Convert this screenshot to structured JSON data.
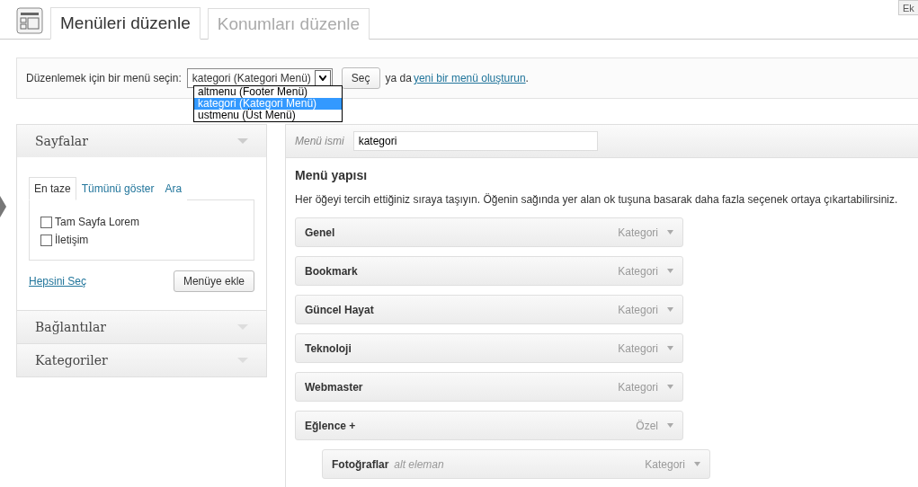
{
  "top_button": "Ek",
  "tabs": [
    {
      "label": "Menüleri düzenle",
      "selected": true
    },
    {
      "label": "Konumları düzenle",
      "selected": false
    }
  ],
  "menu_select": {
    "label": "Düzenlemek için bir menü seçin:",
    "value": "kategori (Kategori Menü)",
    "button": "Seç",
    "or_text": "ya da",
    "create_link": "yeni bir menü oluşturun",
    "end": ".",
    "open": true,
    "options": [
      {
        "label": "altmenu (Footer Menü)",
        "selected": false
      },
      {
        "label": "kategori (Kategori Menü)",
        "selected": true
      },
      {
        "label": "ustmenu (Üst Menü)",
        "selected": false
      }
    ]
  },
  "sidebar": [
    {
      "title": "Sayfalar",
      "expanded": true,
      "tabs": [
        {
          "label": "En taze",
          "selected": true
        },
        {
          "label": "Tümünü göster",
          "selected": false
        },
        {
          "label": "Ara",
          "selected": false
        }
      ],
      "items": [
        {
          "label": "Tam Sayfa Lorem",
          "checked": false
        },
        {
          "label": "İletişim",
          "checked": false
        }
      ],
      "select_all": "Hepsini Seç",
      "add_button": "Menüye ekle"
    },
    {
      "title": "Bağlantılar",
      "expanded": false
    },
    {
      "title": "Kategoriler",
      "expanded": false
    }
  ],
  "editor": {
    "name_label": "Menü ismi",
    "name_value": "kategori",
    "heading": "Menü yapısı",
    "help": "Her öğeyi tercih ettiğiniz sıraya taşıyın. Öğenin sağında yer alan ok tuşuna basarak daha fazla seçenek ortaya çıkartabilirsiniz.",
    "items": [
      {
        "title": "Genel",
        "type": "Kategori"
      },
      {
        "title": "Bookmark",
        "type": "Kategori"
      },
      {
        "title": "Güncel Hayat",
        "type": "Kategori"
      },
      {
        "title": "Teknoloji",
        "type": "Kategori"
      },
      {
        "title": "Webmaster",
        "type": "Kategori"
      },
      {
        "title": "Eğlence +",
        "type": "Özel",
        "children": [
          {
            "title": "Fotoğraflar",
            "note": "alt eleman",
            "type": "Kategori"
          }
        ]
      }
    ]
  }
}
